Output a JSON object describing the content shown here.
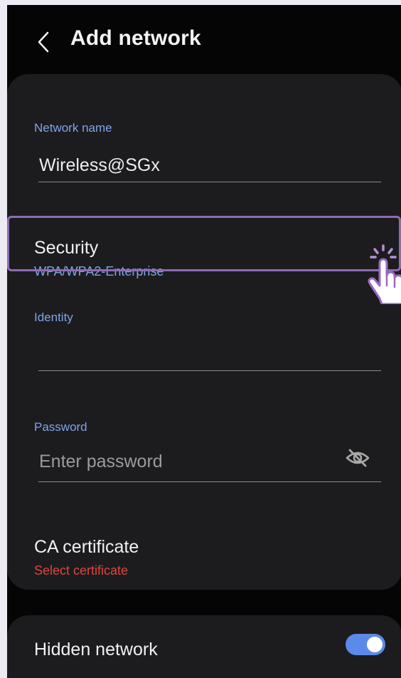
{
  "header": {
    "title": "Add network"
  },
  "network_name": {
    "label": "Network name",
    "value": "Wireless@SGx"
  },
  "security": {
    "title": "Security",
    "value": "WPA/WPA2-Enterprise"
  },
  "identity": {
    "label": "Identity",
    "value": ""
  },
  "password": {
    "label": "Password",
    "placeholder": "Enter password"
  },
  "ca_certificate": {
    "title": "CA certificate",
    "value": "Select certificate"
  },
  "hidden_network": {
    "label": "Hidden network",
    "enabled": true
  },
  "colors": {
    "background": "#050505",
    "card": "#1c1c1e",
    "label_blue": "#7fa4ec",
    "warning_red": "#e0453a",
    "toggle_on": "#5c8ae8",
    "highlight_border": "#8e6bb3"
  },
  "icons": [
    "back-arrow-icon",
    "eye-off-icon",
    "tap-hand-icon"
  ]
}
